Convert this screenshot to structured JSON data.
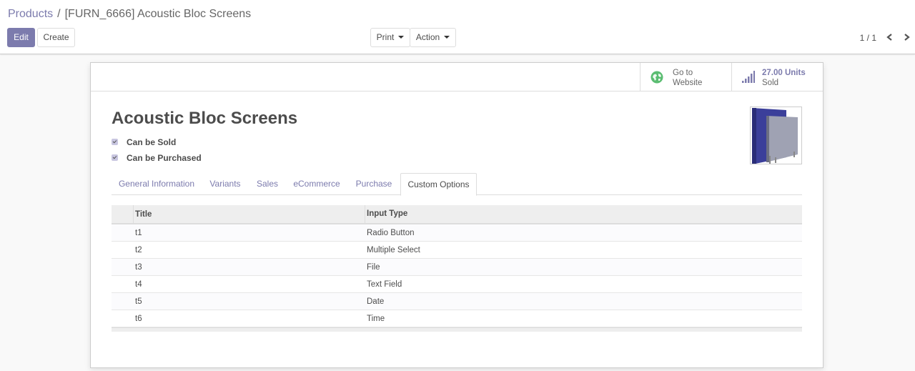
{
  "breadcrumb": {
    "parent": "Products",
    "separator": "/",
    "current": "[FURN_6666] Acoustic Bloc Screens"
  },
  "toolbar": {
    "edit_label": "Edit",
    "create_label": "Create",
    "print_label": "Print",
    "action_label": "Action"
  },
  "pager": {
    "value": "1 / 1",
    "prev_icon": "chevron-left-icon",
    "next_icon": "chevron-right-icon"
  },
  "stat_buttons": {
    "website": {
      "line1": "Go to",
      "line2": "Website",
      "icon": "globe-icon"
    },
    "sold": {
      "value": "27.00 Units",
      "label": "Sold",
      "icon": "signal-bars-icon"
    }
  },
  "product": {
    "name": "Acoustic Bloc Screens",
    "can_be_sold": "Can be Sold",
    "can_be_purchased": "Can be Purchased"
  },
  "tabs": [
    "General Information",
    "Variants",
    "Sales",
    "eCommerce",
    "Purchase",
    "Custom Options"
  ],
  "active_tab": "Custom Options",
  "options_table": {
    "headers": [
      "Title",
      "Input Type"
    ],
    "rows": [
      [
        "t1",
        "Radio Button"
      ],
      [
        "t2",
        "Multiple Select"
      ],
      [
        "t3",
        "File"
      ],
      [
        "t4",
        "Text Field"
      ],
      [
        "t5",
        "Date"
      ],
      [
        "t6",
        "Time"
      ]
    ]
  },
  "colors": {
    "accent": "#7c7bad",
    "text": "#4c4c4c",
    "globe": "#5bbd72"
  }
}
